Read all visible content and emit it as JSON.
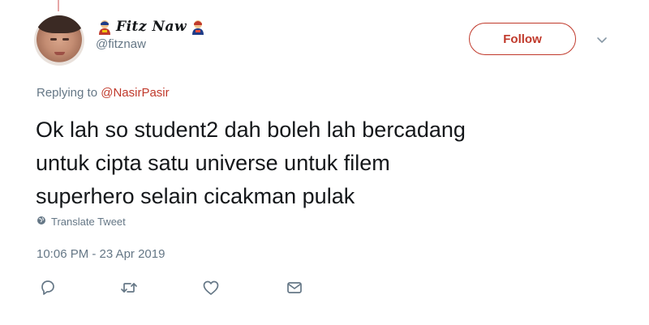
{
  "user": {
    "display_name": "Fitz Naw",
    "handle": "@fitznaw",
    "avatar_icon": "avatar-photo",
    "name_decoration_icon": "superhero-emoji-icon"
  },
  "follow_button": {
    "label": "Follow",
    "color": "#c0392b"
  },
  "menu": {
    "icon": "chevron-down-icon"
  },
  "reply": {
    "prefix": "Replying to",
    "mention": "@NasirPasir"
  },
  "tweet": {
    "line1": "Ok lah so student2 dah boleh lah bercadang",
    "line2": "untuk cipta satu universe untuk filem",
    "line3": "superhero selain cicakman pulak"
  },
  "translate": {
    "label": "Translate Tweet",
    "icon": "globe-icon"
  },
  "timestamp": "10:06 PM - 23 Apr 2019",
  "actions": [
    {
      "name": "reply",
      "icon": "reply-icon"
    },
    {
      "name": "retweet",
      "icon": "retweet-icon"
    },
    {
      "name": "like",
      "icon": "heart-icon"
    },
    {
      "name": "message",
      "icon": "envelope-icon"
    }
  ],
  "colors": {
    "accent": "#c0392b",
    "secondary_text": "#657786",
    "primary_text": "#14171a",
    "icon_gray": "#8899a6"
  }
}
